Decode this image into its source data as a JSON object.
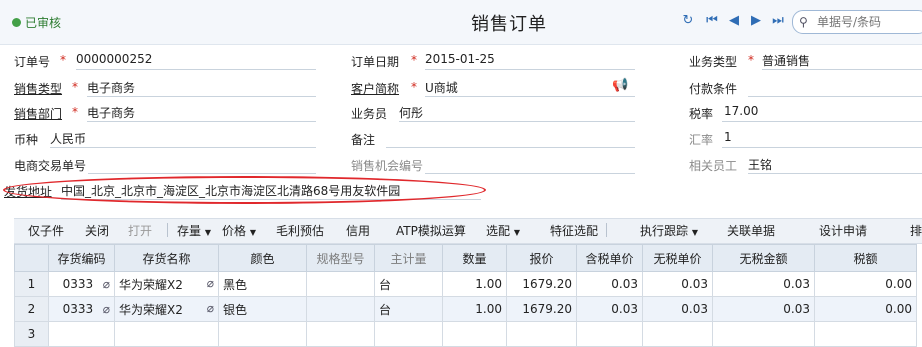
{
  "header": {
    "status": "已审核",
    "title": "销售订单",
    "search_placeholder": "单据号/条码"
  },
  "form": {
    "order_no_label": "订单号",
    "order_no": "0000000252",
    "order_date_label": "订单日期",
    "order_date": "2015-01-25",
    "biz_type_label": "业务类型",
    "biz_type": "普通销售",
    "sales_type_label": "销售类型",
    "sales_type": "电子商务",
    "customer_label": "客户简称",
    "customer": "U商城",
    "payment_label": "付款条件",
    "sales_dept_label": "销售部门",
    "sales_dept": "电子商务",
    "salesman_label": "业务员",
    "salesman": "何彤",
    "tax_rate_label": "税率",
    "tax_rate": "17.00",
    "currency_label": "币种",
    "currency": "人民币",
    "remark_label": "备注",
    "exchange_label": "汇率",
    "exchange": "1",
    "ec_no_label": "电商交易单号",
    "opportunity_label": "销售机会编号",
    "staff_label": "相关员工",
    "staff": "王铭",
    "address_label": "发货地址",
    "address": "中国_北京_北京市_海淀区_北京市海淀区北清路68号用友软件园"
  },
  "toolbar": {
    "items": [
      "仅子件",
      "关闭",
      "打开",
      "存量",
      "价格",
      "毛利预估",
      "信用",
      "ATP模拟运算",
      "选配",
      "特征选配",
      "执行跟踪",
      "关联单据",
      "设计申请",
      "排"
    ]
  },
  "grid": {
    "headers": [
      "存货编码",
      "存货名称",
      "颜色",
      "规格型号",
      "主计量",
      "数量",
      "报价",
      "含税单价",
      "无税单价",
      "无税金额",
      "税额"
    ],
    "rows": [
      {
        "rn": "1",
        "code": "0333",
        "name": "华为荣耀X2",
        "color": "黑色",
        "spec": "",
        "unit": "台",
        "qty": "1.00",
        "quote": "1679.20",
        "tax_price": "0.03",
        "net_price": "0.03",
        "net_amount": "0.03",
        "tax": "0.00"
      },
      {
        "rn": "2",
        "code": "0333",
        "name": "华为荣耀X2",
        "color": "银色",
        "spec": "",
        "unit": "台",
        "qty": "1.00",
        "quote": "1679.20",
        "tax_price": "0.03",
        "net_price": "0.03",
        "net_amount": "0.03",
        "tax": "0.00"
      },
      {
        "rn": "3"
      }
    ]
  }
}
